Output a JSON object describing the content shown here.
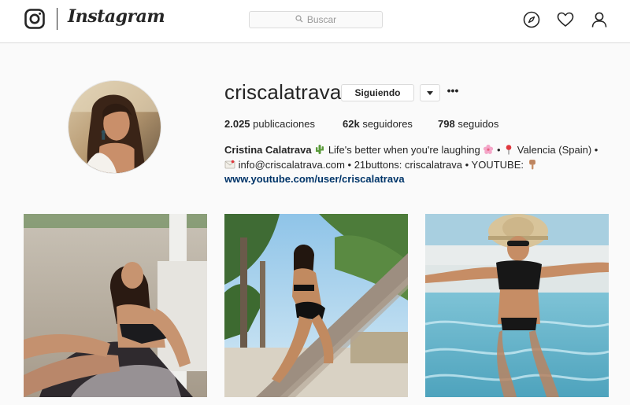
{
  "header": {
    "wordmark": "Instagram",
    "search_placeholder": "Buscar",
    "icons": [
      "instagram-glyph-icon",
      "search-icon",
      "compass-icon",
      "heart-icon",
      "user-icon"
    ]
  },
  "profile": {
    "username": "criscalatrava",
    "follow_button": "Siguiendo",
    "more": "•••",
    "stats": {
      "posts_count": "2.025",
      "posts_label": "publicaciones",
      "followers_count": "62k",
      "followers_label": "seguidores",
      "following_count": "798",
      "following_label": "seguidos"
    },
    "bio": {
      "full_name": "Cristina Calatrava",
      "line1_text": "Life's better when you're laughing",
      "line1_sep": "•",
      "location": "Valencia (Spain) •",
      "line2": "info@criscalatrava.com • 21buttons: criscalatrava • YOUTUBE:",
      "link": "www.youtube.com/user/criscalatrava"
    }
  },
  "posts": [
    {
      "name": "post-beach-sand"
    },
    {
      "name": "post-palm-tree"
    },
    {
      "name": "post-pool"
    }
  ],
  "colors": {
    "background": "#fafafa",
    "border": "#dbdbdb",
    "text": "#262626",
    "link": "#003569"
  }
}
